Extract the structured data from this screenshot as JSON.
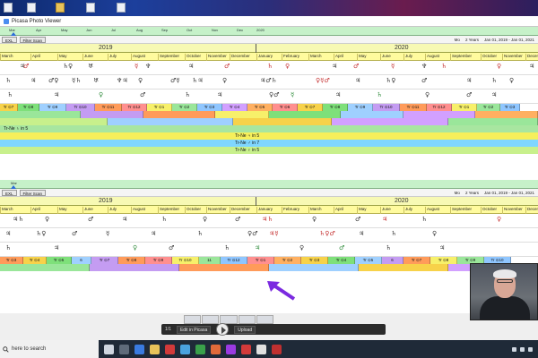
{
  "window": {
    "title": "Picasa Photo Viewer"
  },
  "top_timeline": {
    "overview_months": [
      "Mar",
      "Apr",
      "May",
      "Jun",
      "Jul",
      "Aug",
      "Sep",
      "Oct",
      "Nov",
      "Dec"
    ],
    "overview_year_2020": "2020",
    "buttons": [
      "EXL",
      "Filter Scan"
    ],
    "range": {
      "mo": "Mo",
      "span": "2 Years",
      "dates": "Jan 01, 2019 - Jan 01, 2021"
    },
    "years": [
      "2019",
      "2020"
    ],
    "months": [
      "March",
      "April",
      "May",
      "June",
      "July",
      "August",
      "September",
      "October",
      "November",
      "December",
      "January",
      "February",
      "March",
      "April",
      "May",
      "June",
      "July",
      "August",
      "September",
      "October",
      "November",
      "December"
    ],
    "tr_cells": [
      "Tr ⊙7",
      "Tr ⊙8",
      "Tr ⊙9",
      "Tr ⊙10",
      "Tr ⊙11",
      "Tr ⊙12",
      "Tr ⊙1",
      "Tr ⊙2",
      "Tr ⊙3",
      "Tr ⊙4",
      "Tr ⊙5",
      "Tr ⊙6",
      "Tr ⊙7",
      "Tr ⊙8",
      "Tr ⊙9",
      "Tr ⊙10",
      "Tr ⊙11",
      "Tr ⊙12",
      "Tr ⊙1",
      "Tr ⊙2",
      "Tr ⊙3"
    ],
    "bands": [
      "Tr-Ne ♄ in 5",
      "Tr-Ne ♃ in 5",
      "Tr-Ne ♂ in 7",
      "Tr-Ne ♀ in 5"
    ]
  },
  "bottom_timeline": {
    "overview_label": "Mar",
    "buttons": [
      "EXL",
      "Filter Scan"
    ],
    "range": {
      "mo": "Mo",
      "span": "2 Years",
      "dates": "Jan 01, 2019 - Jan 01, 2021"
    },
    "years": [
      "2019",
      "2020"
    ],
    "months": [
      "March",
      "April",
      "May",
      "June",
      "July",
      "August",
      "September",
      "October",
      "November",
      "December",
      "January",
      "February",
      "March",
      "April",
      "May",
      "June",
      "July",
      "August",
      "September",
      "October",
      "November",
      "December"
    ],
    "tr_cells": [
      "Tr ⊙3",
      "Tr ⊙4",
      "Tr ⊙5",
      "6",
      "Tr ⊙7",
      "Tr ⊙8",
      "Tr ⊙9",
      "Tr ⊙10",
      "11",
      "Tr ⊙12",
      "Tr ⊙1",
      "Tr ⊙2",
      "Tr ⊙3",
      "Tr ⊙4",
      "Tr ⊙5",
      "6",
      "Tr ⊙7",
      "Tr ⊙8",
      "Tr ⊙9",
      "Tr ⊙10"
    ]
  },
  "viewer_toolbar": {
    "counter": "1/1",
    "edit_label": "Edit in Picasa",
    "upload_label": "Upload"
  },
  "taskbar": {
    "search_placeholder": "here to search"
  },
  "colors": {
    "tr_palette": [
      "#f7d24a",
      "#7ee07a",
      "#9fd0ff",
      "#c49cf2",
      "#ff9b5a",
      "#ff8f8f",
      "#f7f06a",
      "#9ae69a",
      "#8fc6ff",
      "#d2a0ff",
      "#ffb061"
    ],
    "band_colors": [
      "#a8e6a0",
      "#f6ef5b",
      "#7fd6ff",
      "#c8f08c"
    ]
  }
}
